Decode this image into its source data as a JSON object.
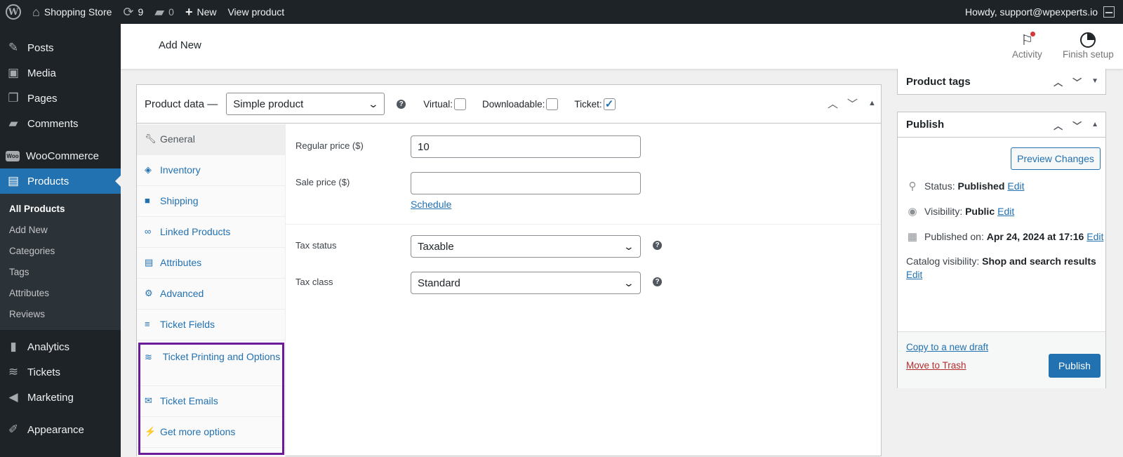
{
  "adminbar": {
    "wp_logo": "W",
    "site_name": "Shopping Store",
    "updates_count": "9",
    "comments_count": "0",
    "new_label": "New",
    "view_label": "View product",
    "howdy": "Howdy, support@wpexperts.io",
    "icons": {
      "home": "home-icon",
      "updates": "refresh-icon",
      "comments": "comment-bubble-icon",
      "new": "plus-icon"
    }
  },
  "sidebar": {
    "items_top": [
      {
        "label": "Posts",
        "icon": "pin-icon"
      },
      {
        "label": "Media",
        "icon": "media-icon"
      },
      {
        "label": "Pages",
        "icon": "pages-icon"
      },
      {
        "label": "Comments",
        "icon": "comment-icon"
      }
    ],
    "woocommerce": {
      "label": "WooCommerce",
      "badge": "Woo"
    },
    "products": {
      "label": "Products"
    },
    "submenu": [
      "All Products",
      "Add New",
      "Categories",
      "Tags",
      "Attributes",
      "Reviews"
    ],
    "items_bottom": [
      {
        "label": "Analytics",
        "icon": "bar-chart-icon"
      },
      {
        "label": "Tickets",
        "icon": "tickets-icon"
      },
      {
        "label": "Marketing",
        "icon": "megaphone-icon"
      },
      {
        "label": "Appearance",
        "icon": "brush-icon"
      }
    ]
  },
  "header": {
    "title": "Add New",
    "activity_label": "Activity",
    "finish_setup_label": "Finish setup"
  },
  "product_data": {
    "title": "Product data —",
    "type_selected": "Simple product",
    "virtual_label": "Virtual:",
    "virtual_checked": false,
    "downloadable_label": "Downloadable:",
    "downloadable_checked": false,
    "ticket_label": "Ticket:",
    "ticket_checked": true,
    "check_mark": "✓",
    "help_glyph": "?",
    "tabs": [
      {
        "label": "General",
        "icon": "wrench-icon"
      },
      {
        "label": "Inventory",
        "icon": "tag-icon"
      },
      {
        "label": "Shipping",
        "icon": "truck-icon"
      },
      {
        "label": "Linked Products",
        "icon": "link-icon"
      },
      {
        "label": "Attributes",
        "icon": "list-table-icon"
      },
      {
        "label": "Advanced",
        "icon": "gear-icon"
      },
      {
        "label": "Ticket Fields",
        "icon": "menu-lines-icon"
      },
      {
        "label": "Ticket Printing and Options",
        "icon": "printer-stack-icon"
      },
      {
        "label": "Ticket Emails",
        "icon": "envelope-icon"
      },
      {
        "label": "Get more options",
        "icon": "plug-icon"
      }
    ],
    "general": {
      "regular_price_label": "Regular price ($)",
      "regular_price_value": "10",
      "sale_price_label": "Sale price ($)",
      "sale_price_value": "",
      "schedule_link": "Schedule",
      "tax_status_label": "Tax status",
      "tax_status_value": "Taxable",
      "tax_class_label": "Tax class",
      "tax_class_value": "Standard"
    }
  },
  "product_tags_box": {
    "title": "Product tags"
  },
  "publish_box": {
    "title": "Publish",
    "preview_label": "Preview Changes",
    "status_label": "Status:",
    "status_value": "Published",
    "visibility_label": "Visibility:",
    "visibility_value": "Public",
    "published_on_label": "Published on:",
    "published_on_value": "Apr 24, 2024 at 17:16",
    "catalog_label": "Catalog visibility:",
    "catalog_value": "Shop and search results",
    "edit_label": "Edit",
    "copy_draft_label": "Copy to a new draft",
    "trash_label": "Move to Trash",
    "publish_label": "Publish",
    "trash_color": "#b32d2e"
  },
  "colors": {
    "accent": "#2271b1",
    "adminbar": "#1d2327",
    "highlight_box": "#6a1b9a"
  }
}
